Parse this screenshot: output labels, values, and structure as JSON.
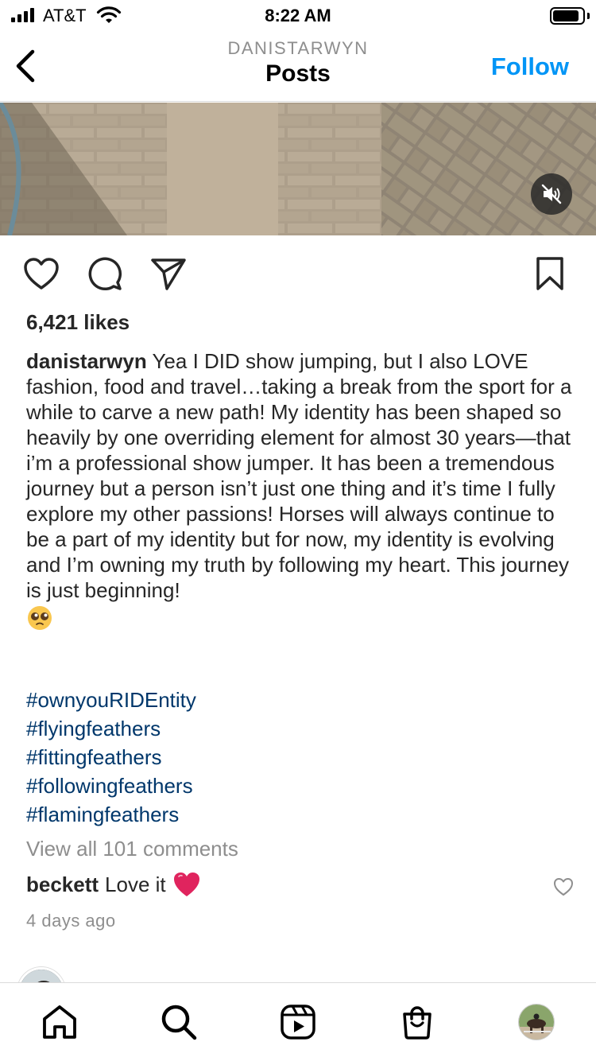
{
  "status_bar": {
    "carrier": "AT&T",
    "time": "8:22 AM",
    "battery_level": 0.9
  },
  "header": {
    "username": "DANISTARWYN",
    "title": "Posts",
    "follow_label": "Follow"
  },
  "post": {
    "likes": "6,421 likes",
    "author": "danistarwyn",
    "caption": " Yea I DID show jumping, but I also LOVE fashion, food and travel…taking a break from the sport for a while to carve a new path!  My identity has been shaped so heavily by one overriding element for almost 30 years—that i’m a professional show jumper.  It has been a tremendous journey but a person isn’t just one thing and it’s time I fully explore my other passions! Horses will always continue to be a part of my identity but for now, my identity is evolving and I’m owning my truth by following my heart.  This journey is just beginning!",
    "caption_emoji": "pleading-face-emoji",
    "hashtags": [
      "#ownyouRIDEntity",
      "#flyingfeathers",
      "#fittingfeathers",
      "#followingfeathers",
      "#flamingfeathers"
    ],
    "view_all_comments": "View all 101 comments",
    "top_comment": {
      "user": "beckett",
      "text": "Love it",
      "emoji": "red-heart-emoji"
    },
    "timestamp": "4 days ago"
  },
  "icons": {
    "back": "chevron-left-icon",
    "mute": "speaker-muted-icon",
    "like": "heart-icon",
    "comment": "comment-bubble-icon",
    "share": "paper-plane-icon",
    "save": "bookmark-icon",
    "nav": [
      "home-icon",
      "search-icon",
      "reels-icon",
      "shop-icon",
      "profile-avatar"
    ]
  },
  "colors": {
    "accent": "#0095f6",
    "hashtag": "#00376b",
    "muted": "#8e8e8e",
    "text": "#262626"
  }
}
